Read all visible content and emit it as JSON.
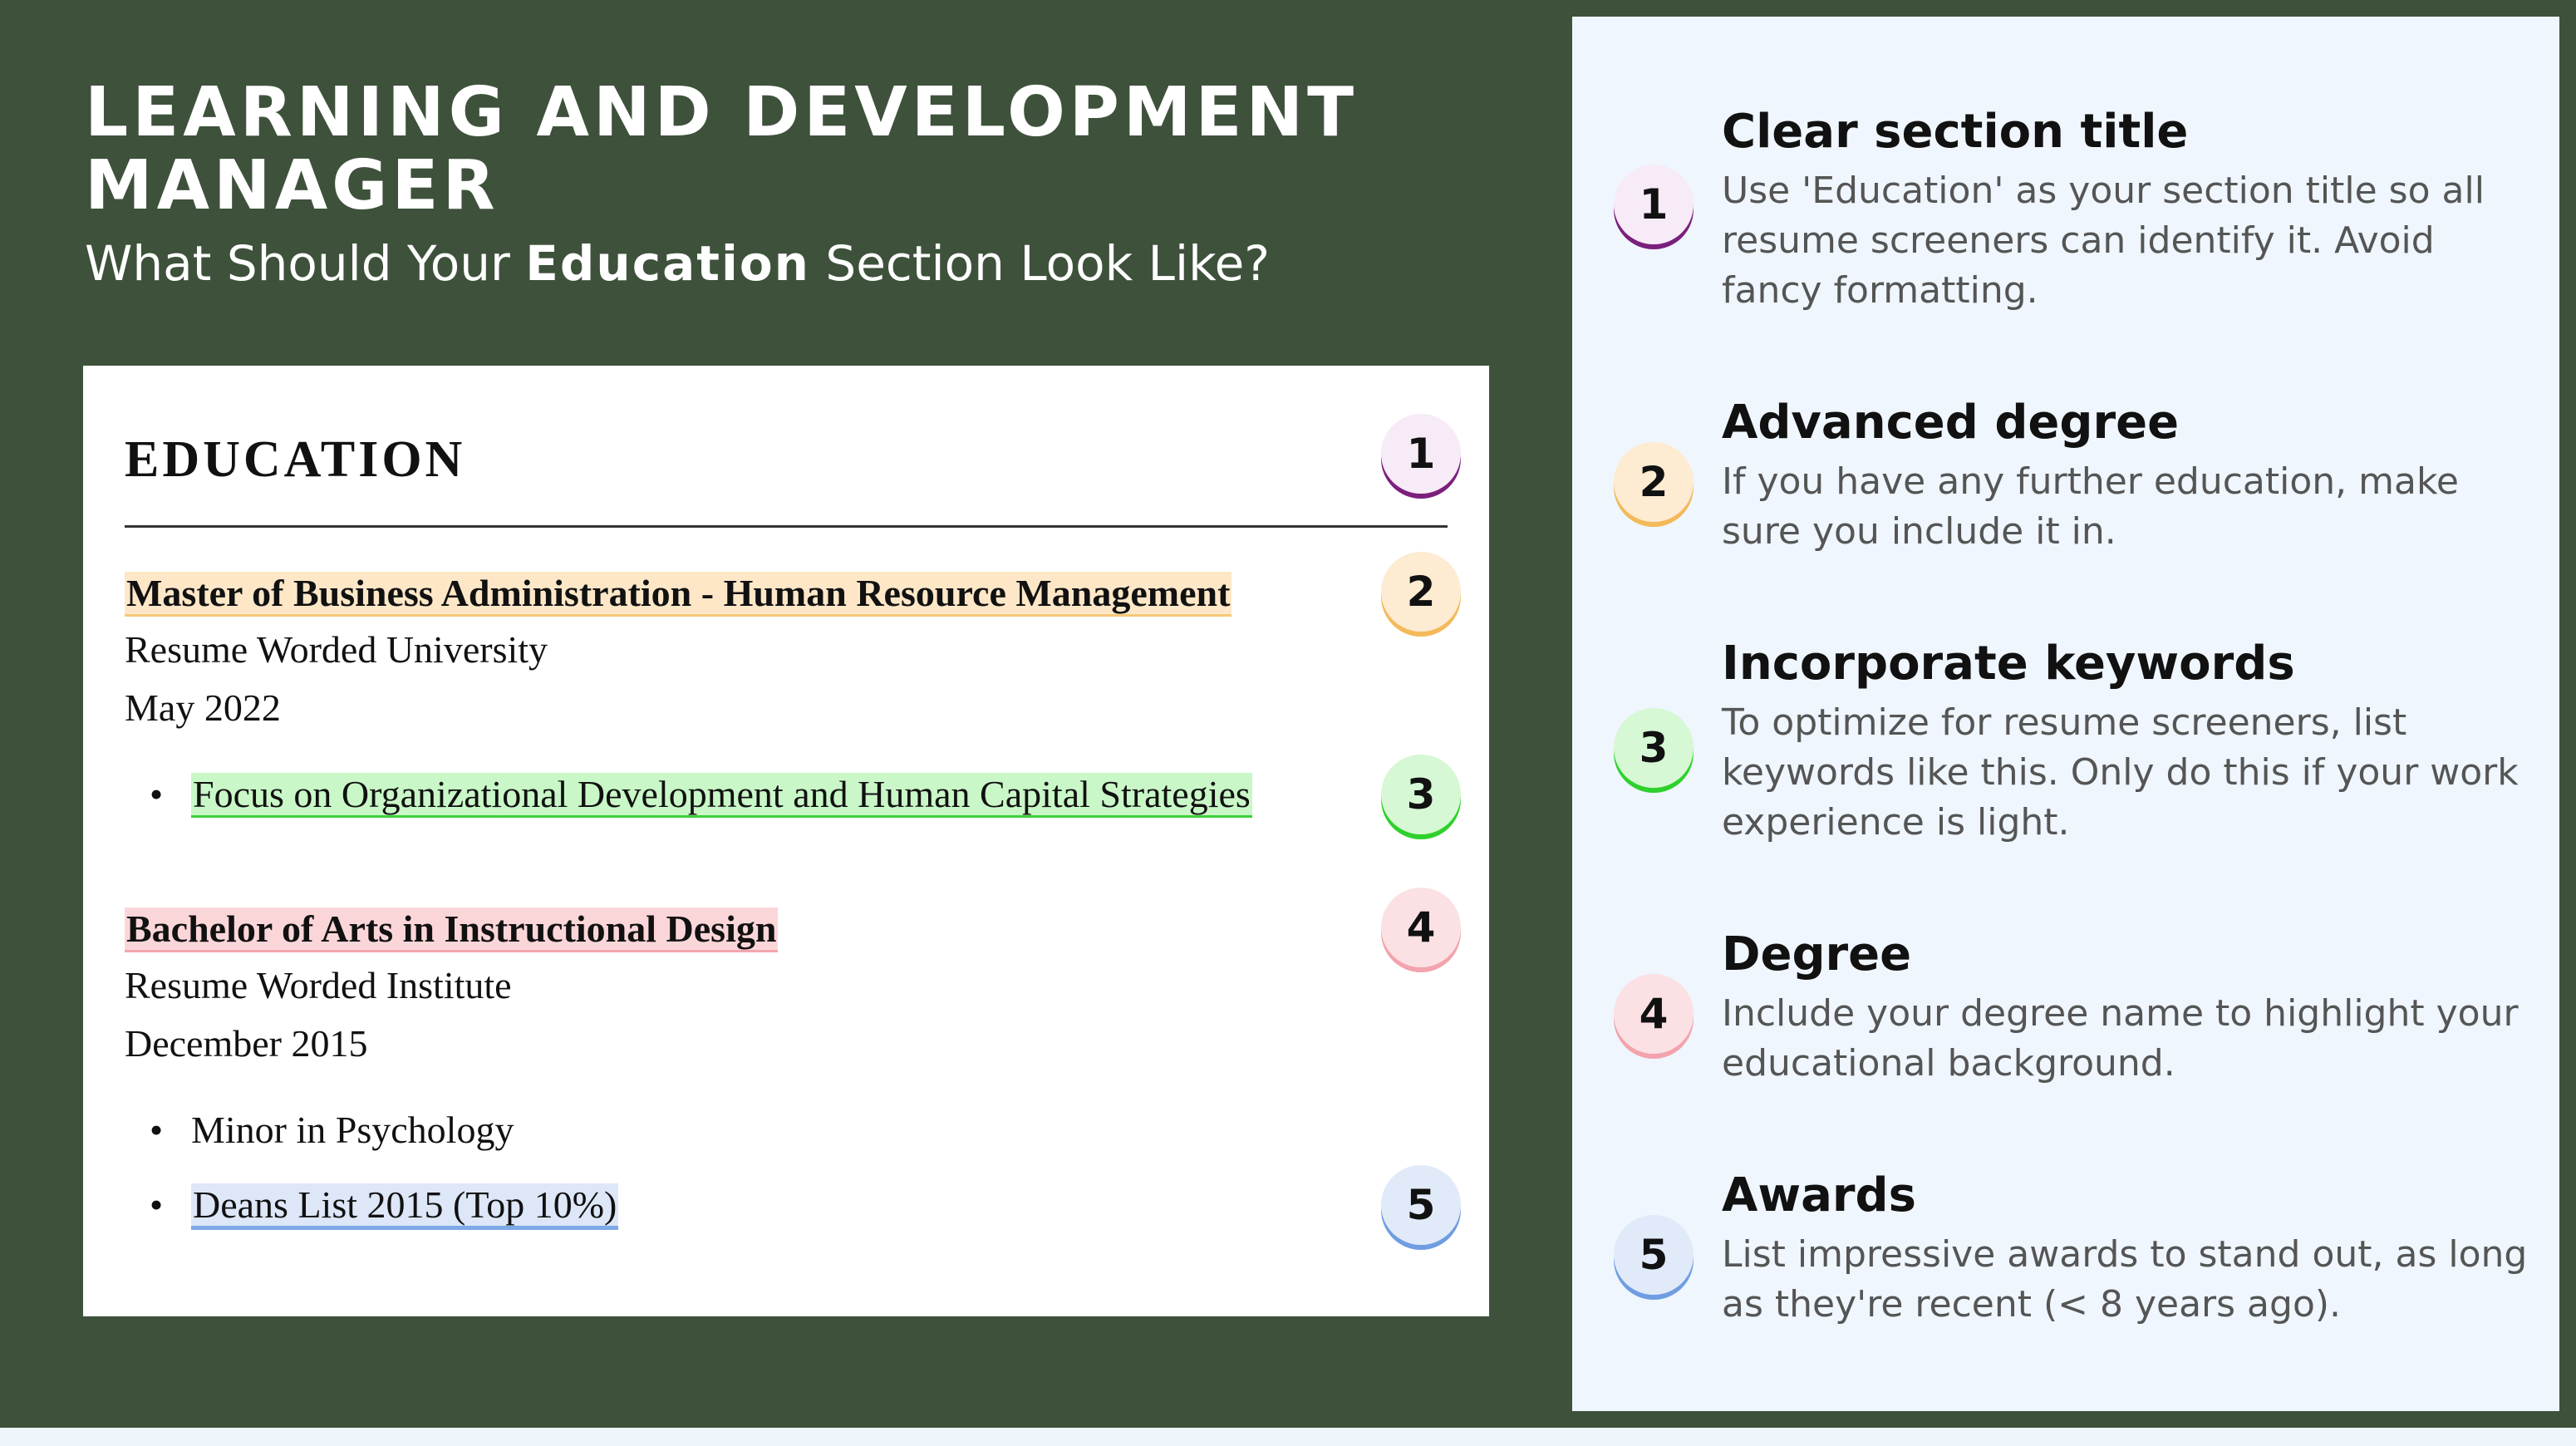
{
  "header": {
    "title": "LEARNING AND DEVELOPMENT MANAGER",
    "subtitle_before": "What Should Your ",
    "subtitle_bold": "Education",
    "subtitle_after": " Section Look Like?"
  },
  "resume": {
    "section_title": "EDUCATION",
    "entries": [
      {
        "degree": "Master of Business Administration - Human Resource Management",
        "school": "Resume Worded University",
        "date": "May 2022",
        "bullets": [
          "Focus on Organizational Development and Human Capital Strategies"
        ]
      },
      {
        "degree": "Bachelor of Arts in Instructional Design",
        "school": "Resume Worded Institute",
        "date": "December 2015",
        "bullets": [
          "Minor in Psychology",
          "Deans List 2015 (Top 10%)"
        ]
      }
    ],
    "bullet_char": "•",
    "badges": [
      "1",
      "2",
      "3",
      "4",
      "5"
    ]
  },
  "tips": [
    {
      "num": "1",
      "title": "Clear section title",
      "body": "Use 'Education' as your section title so all resume screeners can identify it. Avoid fancy formatting."
    },
    {
      "num": "2",
      "title": "Advanced degree",
      "body": "If you have any further education, make sure you include it in."
    },
    {
      "num": "3",
      "title": "Incorporate keywords",
      "body": "To optimize for resume screeners, list keywords like this. Only do this if your work experience is light."
    },
    {
      "num": "4",
      "title": "Degree",
      "body": "Include your degree name to highlight your educational background."
    },
    {
      "num": "5",
      "title": "Awards",
      "body": "List impressive awards to stand out, as long as they're recent (< 8 years ago)."
    }
  ],
  "colors": {
    "background_green": "#3e523b",
    "panel_bg": "#eff6fd",
    "highlight_1": "#7b1f7d",
    "highlight_2": "#f3b95a",
    "highlight_3": "#2ed12c",
    "highlight_4": "#f3a3ad",
    "highlight_5": "#6f9de2"
  }
}
